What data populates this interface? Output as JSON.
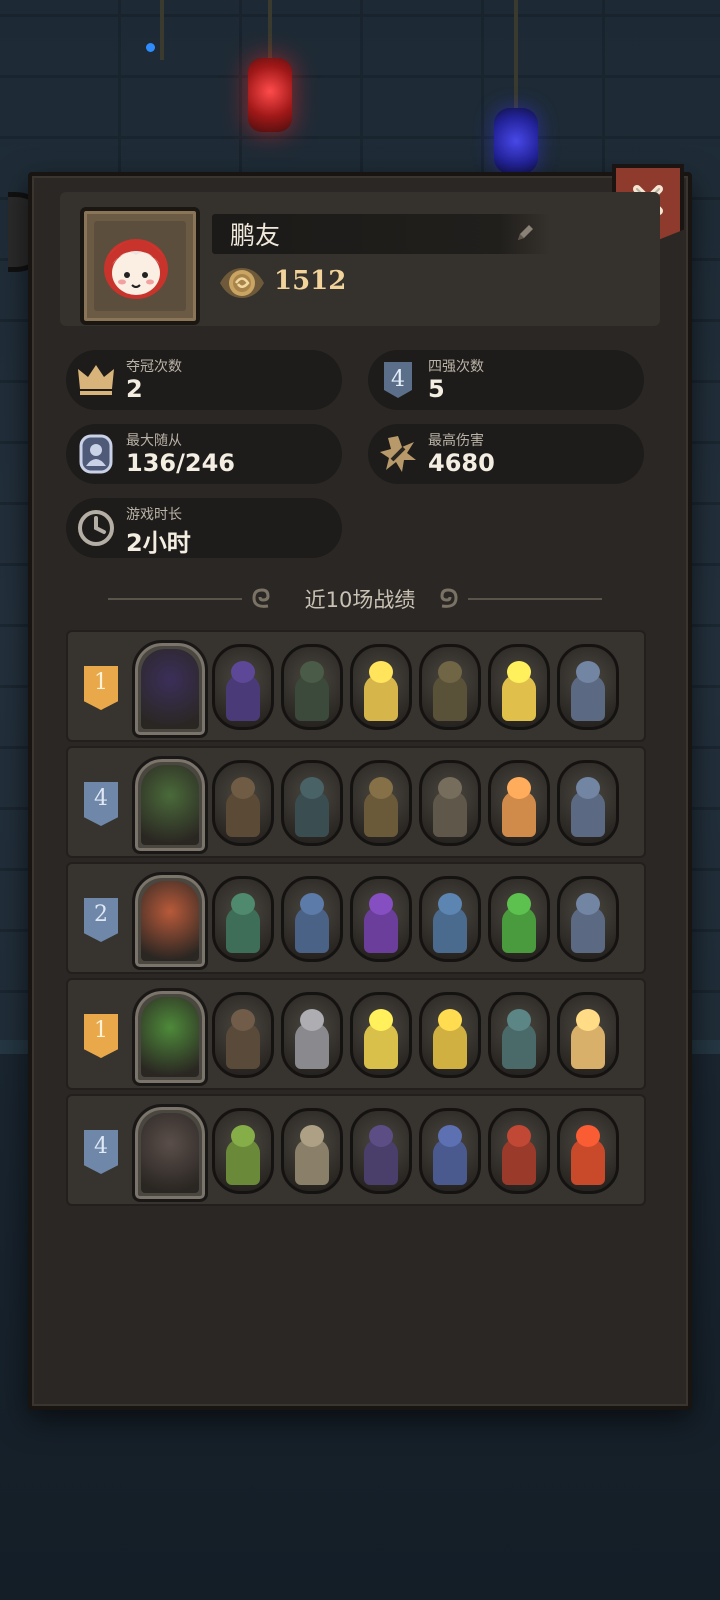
{
  "player": {
    "name": "鹏友",
    "coins": "1512"
  },
  "stats": [
    {
      "label": "夺冠次数",
      "value": "2",
      "icon": "crown-icon"
    },
    {
      "label": "四强次数",
      "value": "5",
      "icon": "top4-badge-icon"
    },
    {
      "label": "最大随从",
      "value": "136/246",
      "icon": "minion-icon"
    },
    {
      "label": "最高伤害",
      "value": "4680",
      "icon": "damage-burst-icon"
    },
    {
      "label": "游戏时长",
      "value": "2小时",
      "icon": "clock-icon"
    }
  ],
  "top4_badge_text": "4",
  "history": {
    "title": "近10场战绩",
    "matches": [
      {
        "rank": "1",
        "tier": "gold",
        "hero_color": "#3b2f5a",
        "units": [
          "#4a3a78",
          "#3b4a3a",
          "#d6b64a",
          "#5a5238",
          "#e0c04a",
          "#5b6a82"
        ]
      },
      {
        "rank": "4",
        "tier": "blue",
        "hero_color": "#4a6a3a",
        "units": [
          "#5a4a36",
          "#3a4e52",
          "#6a5a3a",
          "#5e574a",
          "#d08a4a",
          "#5b6a82"
        ]
      },
      {
        "rank": "2",
        "tier": "blue",
        "hero_color": "#b85a3a",
        "units": [
          "#3f6e58",
          "#4a6286",
          "#6a3e9a",
          "#4a6a8e",
          "#4a9a3e",
          "#5b6a82"
        ]
      },
      {
        "rank": "1",
        "tier": "gold",
        "hero_color": "#4e8a3a",
        "units": [
          "#5a4a3a",
          "#8a8a8e",
          "#d8c04a",
          "#d0b040",
          "#4a6a6a",
          "#d8b06a"
        ]
      },
      {
        "rank": "4",
        "tier": "blue",
        "hero_color": "#5a4e4a",
        "units": [
          "#6a8a3a",
          "#8a806a",
          "#4a3e6a",
          "#4a5a8e",
          "#9a3a2a",
          "#c84a2a"
        ]
      }
    ]
  },
  "colors": {
    "panel": "#2a2724",
    "gold_rank": "#e9a94b",
    "blue_rank": "#6f87a8",
    "close_button": "#8e3a2c"
  }
}
